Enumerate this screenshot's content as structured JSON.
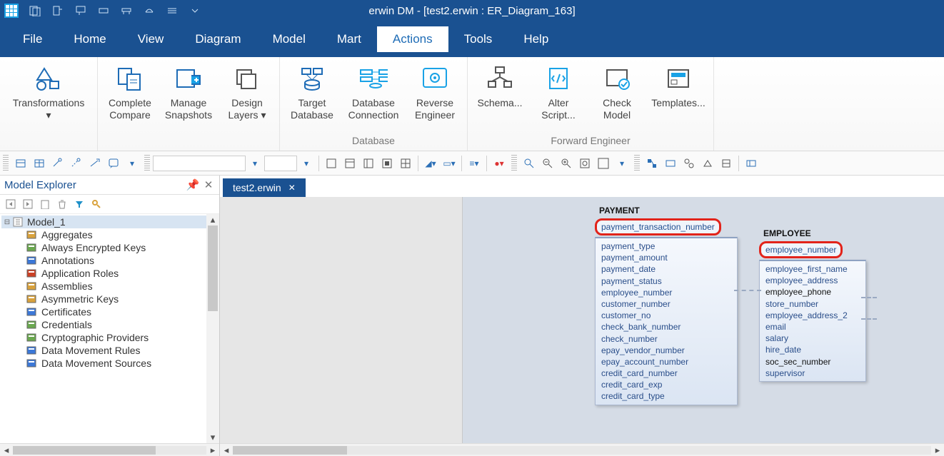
{
  "title": "erwin DM - [test2.erwin : ER_Diagram_163]",
  "menu": [
    "File",
    "Home",
    "View",
    "Diagram",
    "Model",
    "Mart",
    "Actions",
    "Tools",
    "Help"
  ],
  "menu_active_index": 6,
  "ribbon": {
    "groups": [
      {
        "label": "",
        "buttons": [
          {
            "id": "transformations",
            "label": "Transformations\n▾",
            "icon": "shapes"
          }
        ]
      },
      {
        "label": "",
        "buttons": [
          {
            "id": "complete-compare",
            "label": "Complete\nCompare",
            "icon": "compare"
          },
          {
            "id": "manage-snapshots",
            "label": "Manage\nSnapshots",
            "icon": "snapshot"
          },
          {
            "id": "design-layers",
            "label": "Design\nLayers ▾",
            "icon": "layers"
          }
        ]
      },
      {
        "label": "Database",
        "buttons": [
          {
            "id": "target-database",
            "label": "Target\nDatabase",
            "icon": "target-db"
          },
          {
            "id": "database-connection",
            "label": "Database\nConnection",
            "icon": "db-conn"
          },
          {
            "id": "reverse-engineer",
            "label": "Reverse\nEngineer",
            "icon": "gear"
          }
        ]
      },
      {
        "label": "Forward Engineer",
        "buttons": [
          {
            "id": "schema",
            "label": "Schema...",
            "icon": "schema"
          },
          {
            "id": "alter-script",
            "label": "Alter\nScript...",
            "icon": "script"
          },
          {
            "id": "check-model",
            "label": "Check\nModel",
            "icon": "check"
          },
          {
            "id": "templates",
            "label": "Templates...",
            "icon": "template"
          }
        ]
      }
    ]
  },
  "explorer": {
    "title": "Model Explorer",
    "root": "Model_1",
    "items": [
      "Aggregates",
      "Always Encrypted Keys",
      "Annotations",
      "Application Roles",
      "Assemblies",
      "Asymmetric Keys",
      "Certificates",
      "Credentials",
      "Cryptographic Providers",
      "Data Movement Rules",
      "Data Movement Sources"
    ]
  },
  "doc_tab": "test2.erwin",
  "entities": {
    "payment": {
      "title": "PAYMENT",
      "pk": "payment_transaction_number",
      "attrs": [
        {
          "t": "payment_type"
        },
        {
          "t": "payment_amount"
        },
        {
          "t": "payment_date"
        },
        {
          "t": "payment_status"
        },
        {
          "t": "employee_number"
        },
        {
          "t": "customer_number"
        },
        {
          "t": "customer_no"
        },
        {
          "t": "check_bank_number"
        },
        {
          "t": "check_number"
        },
        {
          "t": "epay_vendor_number"
        },
        {
          "t": "epay_account_number"
        },
        {
          "t": "credit_card_number"
        },
        {
          "t": "credit_card_exp"
        },
        {
          "t": "credit_card_type"
        }
      ]
    },
    "employee": {
      "title": "EMPLOYEE",
      "pk": "employee_number",
      "attrs": [
        {
          "t": "employee_first_name"
        },
        {
          "t": "employee_address"
        },
        {
          "t": "employee_phone",
          "dark": true
        },
        {
          "t": "store_number"
        },
        {
          "t": "employee_address_2"
        },
        {
          "t": "email"
        },
        {
          "t": "salary"
        },
        {
          "t": "hire_date"
        },
        {
          "t": "soc_sec_number",
          "dark": true
        },
        {
          "t": "supervisor"
        }
      ]
    }
  }
}
